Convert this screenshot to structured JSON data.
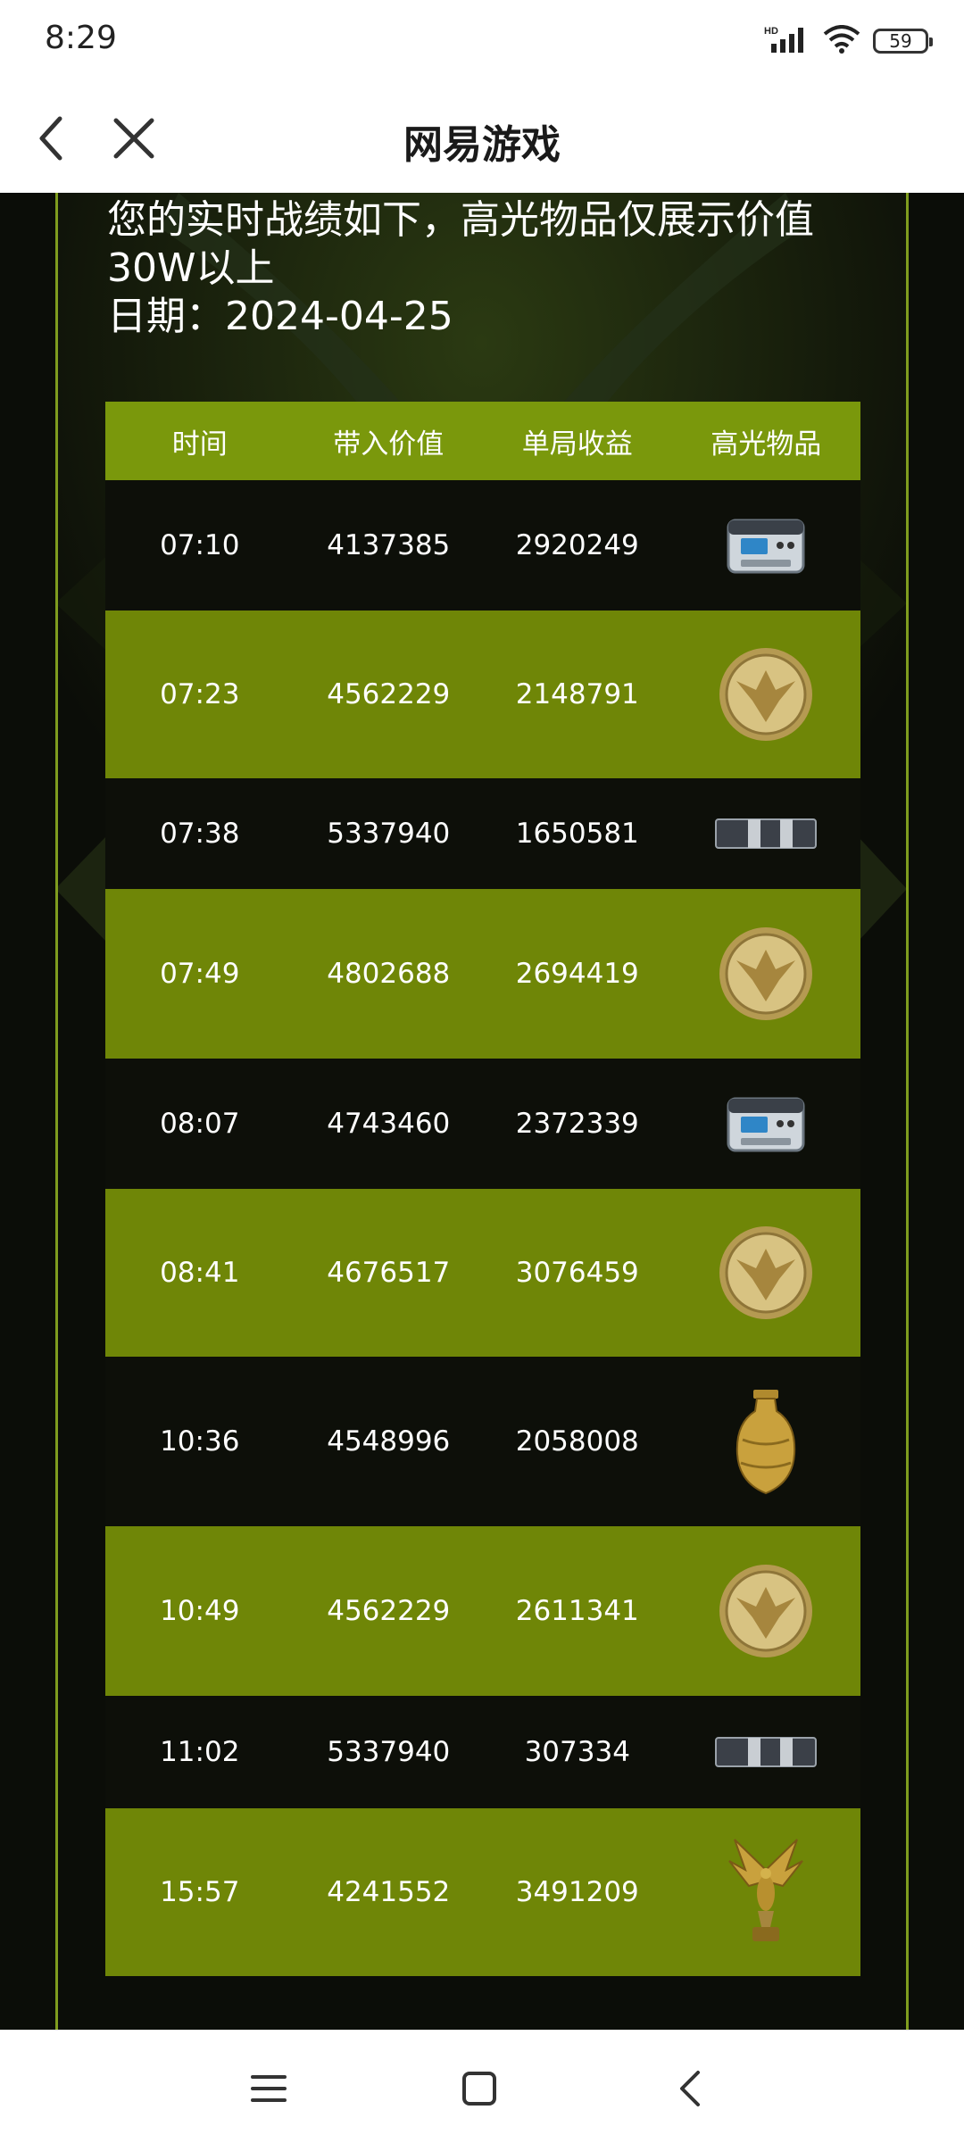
{
  "status_bar": {
    "time": "8:29",
    "network_label": "HD",
    "battery": "59"
  },
  "header": {
    "title": "网易游戏",
    "back_icon": "chevron-left-icon",
    "close_icon": "close-icon"
  },
  "intro": {
    "line1": "您的实时战绩如下，高光物品仅展示价值",
    "line2": "30W以上",
    "line3": "日期：2024-04-25"
  },
  "table": {
    "headers": [
      "时间",
      "带入价值",
      "单局收益",
      "高光物品"
    ],
    "rows": [
      {
        "time": "07:10",
        "value": "4137385",
        "profit": "2920249",
        "item_icon": "power-station-icon"
      },
      {
        "time": "07:23",
        "value": "4562229",
        "profit": "2148791",
        "item_icon": "gold-coin-icon"
      },
      {
        "time": "07:38",
        "value": "5337940",
        "profit": "1650581",
        "item_icon": "battery-pack-icon"
      },
      {
        "time": "07:49",
        "value": "4802688",
        "profit": "2694419",
        "item_icon": "gold-coin-icon"
      },
      {
        "time": "08:07",
        "value": "4743460",
        "profit": "2372339",
        "item_icon": "power-station-icon"
      },
      {
        "time": "08:41",
        "value": "4676517",
        "profit": "3076459",
        "item_icon": "gold-coin-icon"
      },
      {
        "time": "10:36",
        "value": "4548996",
        "profit": "2058008",
        "item_icon": "golden-vase-icon"
      },
      {
        "time": "10:49",
        "value": "4562229",
        "profit": "2611341",
        "item_icon": "gold-coin-icon"
      },
      {
        "time": "11:02",
        "value": "5337940",
        "profit": "307334",
        "item_icon": "battery-pack-icon"
      },
      {
        "time": "15:57",
        "value": "4241552",
        "profit": "3491209",
        "item_icon": "golden-eagle-icon"
      }
    ]
  },
  "nav_bar": {
    "menu_icon": "menu-icon",
    "home_icon": "home-square-icon",
    "back_icon": "back-triangle-icon"
  },
  "colors": {
    "accent_green": "#7a980c",
    "row_green": "#6f8607",
    "row_dark": "#0d0f09",
    "page_bg": "#0b0d08"
  }
}
